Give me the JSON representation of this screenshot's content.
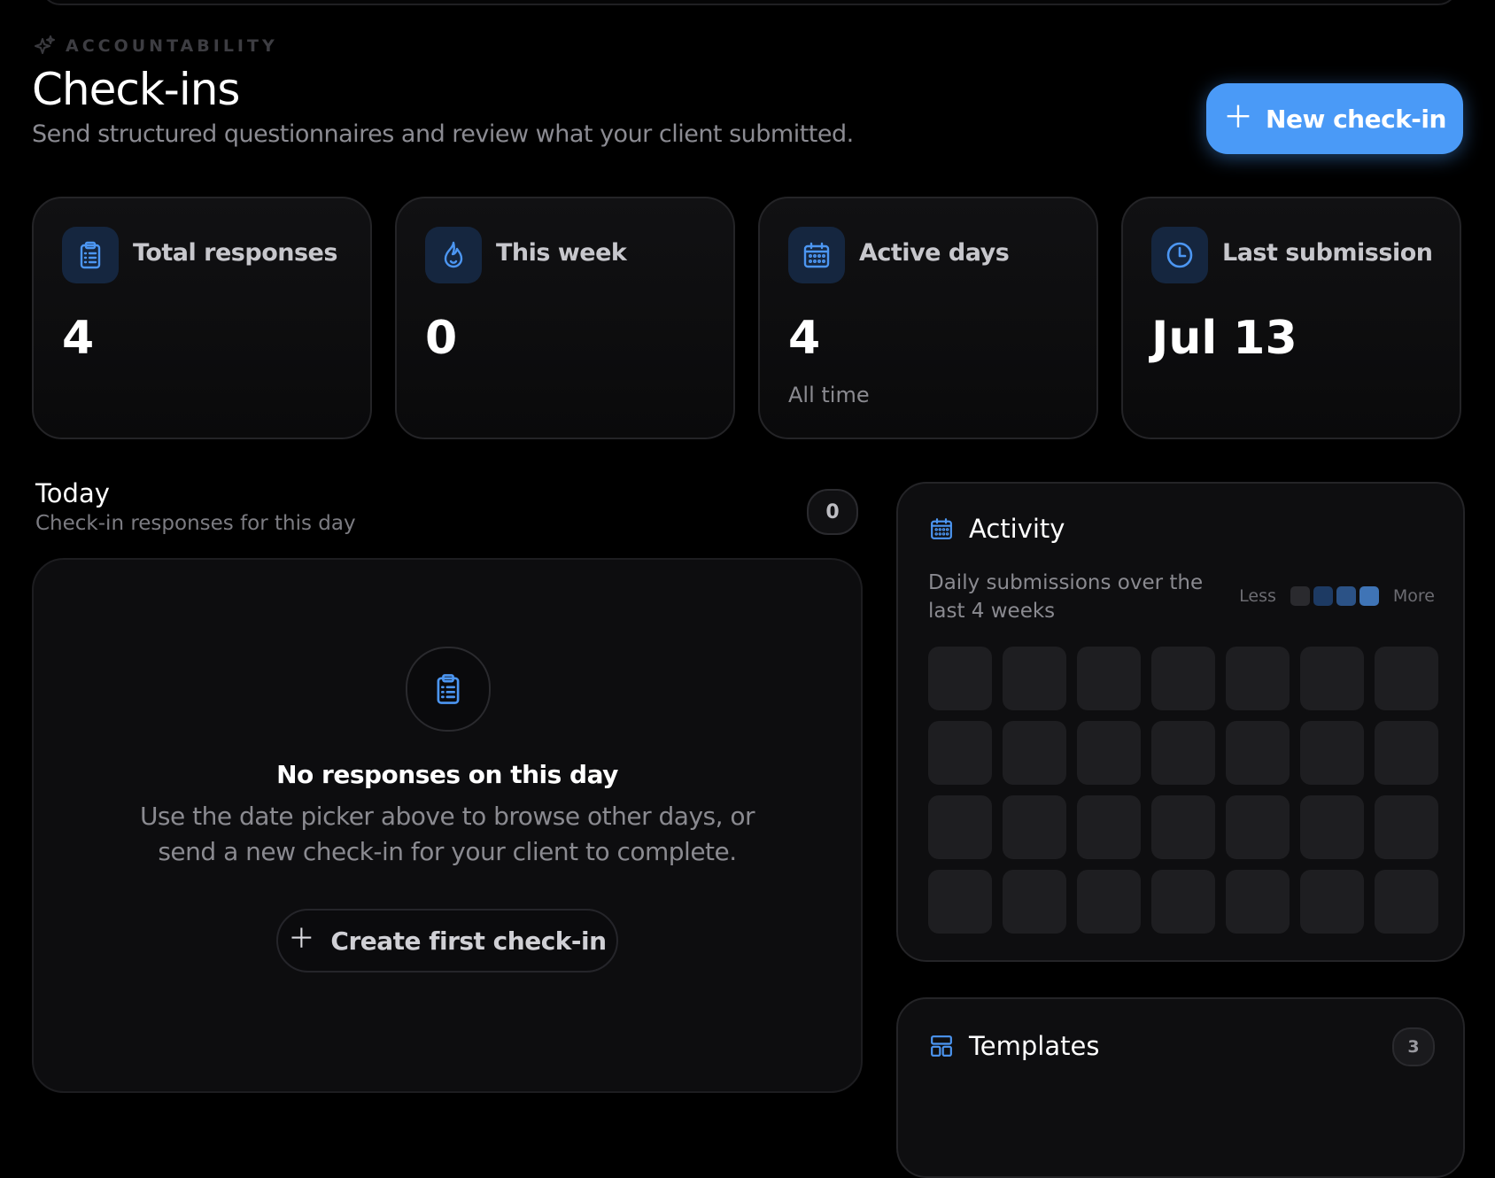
{
  "header": {
    "eyebrow": "ACCOUNTABILITY",
    "eyebrow_icon": "sparkles-icon",
    "title": "Check-ins",
    "subtitle": "Send structured questionnaires and review what your client submitted.",
    "new_button_label": "New check-in"
  },
  "stats": [
    {
      "label": "Total responses",
      "value": "4",
      "sub": "",
      "icon": "clipboard-list-icon"
    },
    {
      "label": "This week",
      "value": "0",
      "sub": "",
      "icon": "flame-icon"
    },
    {
      "label": "Active days",
      "value": "4",
      "sub": "All time",
      "icon": "calendar-icon"
    },
    {
      "label": "Last submission",
      "value": "Jul 13",
      "sub": "",
      "icon": "clock-icon"
    }
  ],
  "today": {
    "title": "Today",
    "subtitle": "Check-in responses for this day",
    "count": "0",
    "empty_title": "No responses on this day",
    "empty_desc": "Use the date picker above to browse other days, or send a new check-in for your client to complete.",
    "create_button_label": "Create first check-in"
  },
  "activity": {
    "title": "Activity",
    "description": "Daily submissions over the last 4 weeks",
    "legend_less": "Less",
    "legend_more": "More",
    "legend_colors": [
      "#2a2a2e",
      "#1d3a63",
      "#2b5286",
      "#3f74b6"
    ],
    "weeks": 4,
    "days_per_week": 7,
    "empty_cell_color": "#1e1e21"
  },
  "templates": {
    "title": "Templates",
    "count": "3"
  },
  "colors": {
    "accent": "#4a9af7",
    "icon_accent": "#4c96f2",
    "background": "#000000"
  }
}
